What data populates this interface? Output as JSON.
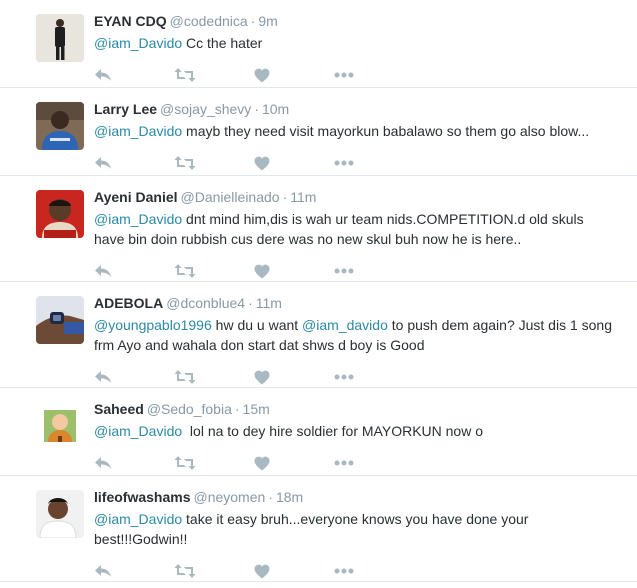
{
  "tweets": [
    {
      "name": "EYAN CDQ",
      "handle": "@codednica",
      "time": "9m",
      "mention": "@iam_Davido",
      "text": " Cc the hater",
      "avatar": "avatar-man-standing"
    },
    {
      "name": "Larry Lee",
      "handle": "@sojay_shevy",
      "time": "10m",
      "mention": "@iam_Davido",
      "text": " mayb they need visit mayorkun babalawo so them go also blow...",
      "avatar": "avatar-man-blue"
    },
    {
      "name": "Ayeni Daniel",
      "handle": "@Danielleinado",
      "time": "11m",
      "mention": "@iam_Davido",
      "text": " dnt mind him,dis is wah ur team nids.COMPETITION.d old skuls have bin doin rubbish cus dere was no new skul buh now he is here..",
      "avatar": "avatar-man-red"
    },
    {
      "name": "ADEBOLA",
      "handle": "@dconblue4",
      "time": "11m",
      "mention": "@youngpablo1996",
      "text_part1": " hw du u want ",
      "mention2": "@iam_davido",
      "text": " to push dem again? Just dis 1 song frm Ayo and wahala don start dat shws d boy is Good",
      "avatar": "avatar-hand-watch"
    },
    {
      "name": "Saheed",
      "handle": "@Sedo_fobia",
      "time": "15m",
      "mention": "@iam_Davido",
      "text": "  lol na to dey hire soldier for MAYORKUN now o",
      "avatar": "avatar-cartoon"
    },
    {
      "name": "lifeofwashams",
      "handle": "@neyomen",
      "time": "18m",
      "mention": "@iam_Davido",
      "text": " take it easy bruh...everyone knows you have done your best!!!Godwin!!",
      "avatar": "avatar-man-white"
    }
  ],
  "dot": "·",
  "icons": {
    "reply": "reply-icon",
    "retweet": "retweet-icon",
    "like": "heart-icon",
    "more": "more-icon"
  },
  "colors": {
    "mention": "#2b8aa6",
    "meta": "#8899a6",
    "action": "#aab8c2",
    "divider": "#e1e8ed"
  }
}
